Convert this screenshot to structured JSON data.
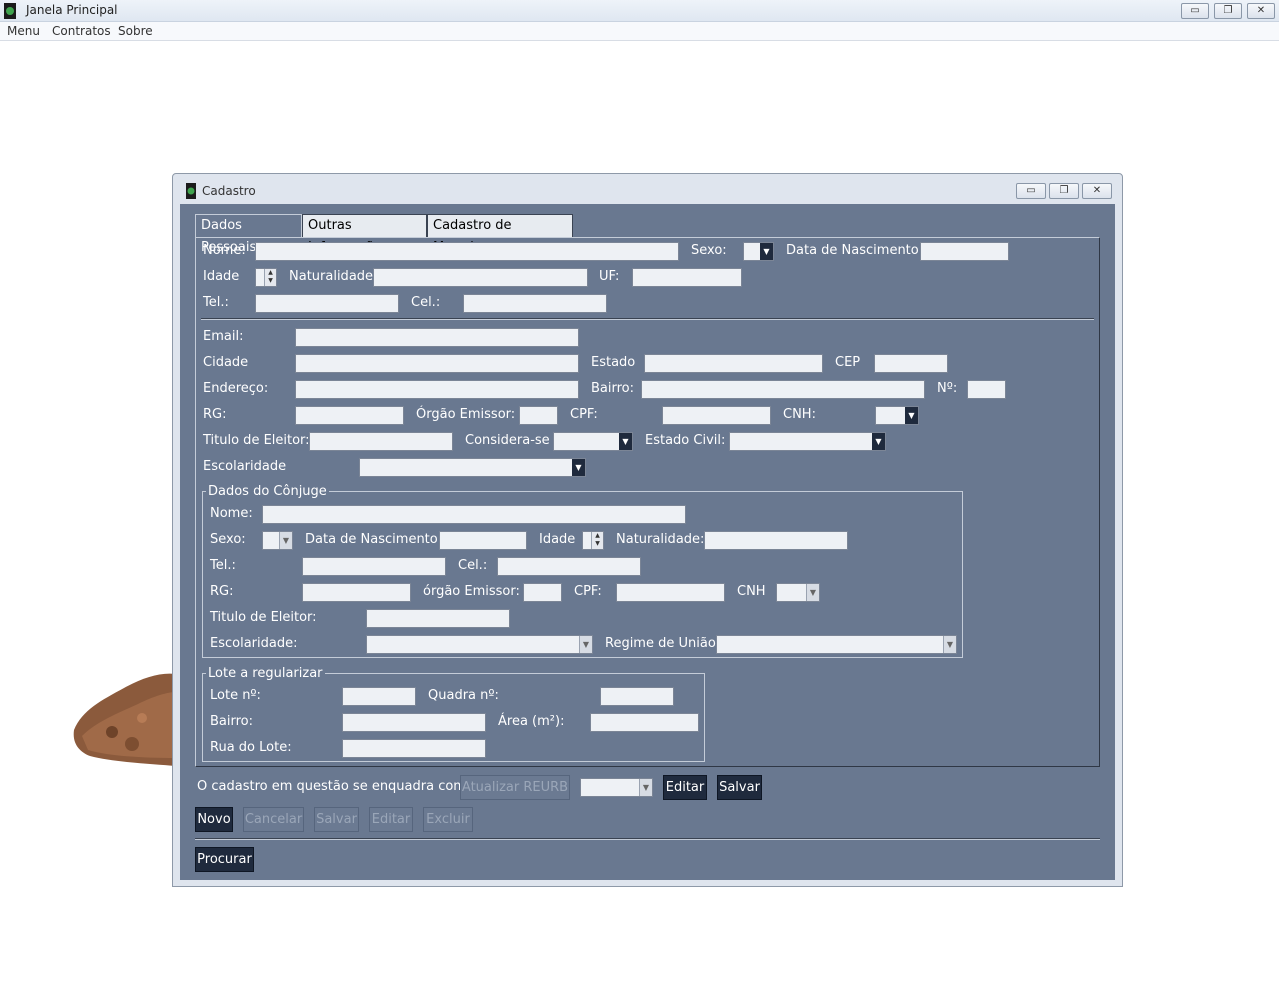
{
  "main_window": {
    "title": "Janela Principal",
    "menu": [
      "Menu",
      "Contratos",
      "Sobre"
    ],
    "controls": {
      "minimize": "▭",
      "restore": "❐",
      "close": "✕"
    }
  },
  "cadastro": {
    "title": "Cadastro",
    "tabs": [
      "Dados Pessoais",
      "Outras Inforamções",
      "Cadastro de Moradores"
    ],
    "pessoais": {
      "nome": "Nome:",
      "sexo": "Sexo:",
      "data_nasc": "Data de Nascimento:",
      "idade": "Idade",
      "naturalidade": "Naturalidade",
      "uf": "UF:",
      "tel": "Tel.:",
      "cel": "Cel.:",
      "email": "Email:",
      "cidade": "Cidade",
      "estado": "Estado",
      "cep": "CEP",
      "endereco": "Endereço:",
      "bairro": "Bairro:",
      "numero": "Nº:",
      "rg": "RG:",
      "orgao": "Órgão Emissor:",
      "cpf": "CPF:",
      "cnh": "CNH:",
      "titulo": "Titulo de Eleitor:",
      "considera": "Considera-se",
      "estado_civil": "Estado Civil:",
      "escolaridade": "Escolaridade"
    },
    "conjuge": {
      "group": "Dados do Cônjuge",
      "nome": "Nome:",
      "sexo": "Sexo:",
      "data_nasc": "Data de Nascimento:",
      "idade": "Idade",
      "naturalidade": "Naturalidade:",
      "tel": "Tel.:",
      "cel": "Cel.:",
      "rg": "RG:",
      "orgao": "órgão Emissor:",
      "cpf": "CPF:",
      "cnh": "CNH",
      "titulo": "Titulo de Eleitor:",
      "escolaridade": "Escolaridade:",
      "regime": "Regime de União"
    },
    "lote": {
      "group": "Lote a regularizar",
      "lote": "Lote nº:",
      "quadra": "Quadra nº:",
      "bairro": "Bairro:",
      "area": "Área (m²):",
      "rua": "Rua do Lote:"
    },
    "reurb": {
      "label": "O cadastro em questão se enquadra como:",
      "atualizar": "Atualizar REURB",
      "editar": "Editar",
      "salvar": "Salvar"
    },
    "actions": {
      "novo": "Novo",
      "cancelar": "Cancelar",
      "salvar": "Salvar",
      "editar": "Editar",
      "excluir": "Excluir",
      "procurar": "Procurar"
    },
    "colors": {
      "panel": "#697890",
      "button": "#1f2a3d",
      "field": "#eef1f5"
    }
  }
}
